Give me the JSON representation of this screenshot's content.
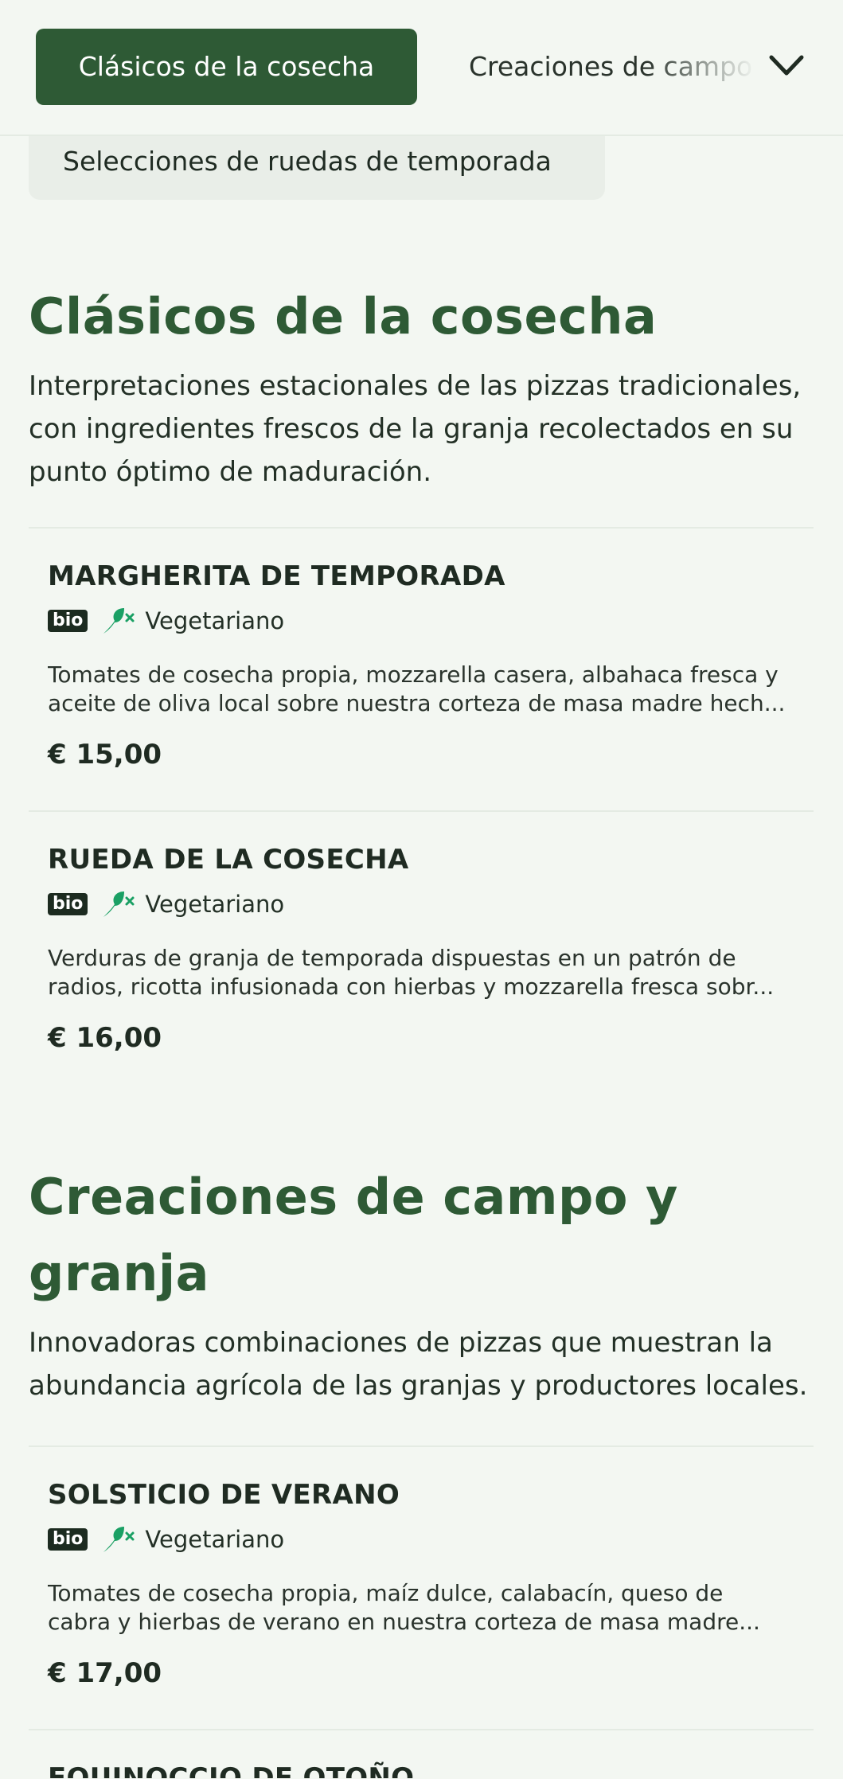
{
  "nav": {
    "active_tab": "Clásicos de la cosecha",
    "next_tab": "Creaciones de campo y granja",
    "subcategory": "Selecciones de ruedas de temporada"
  },
  "sections": [
    {
      "title": "Clásicos de la cosecha",
      "description": "Interpretaciones estacionales de las pizzas tradicionales, con ingredientes frescos de la granja recolectados en su punto óptimo de maduración.",
      "items": [
        {
          "name": "MARGHERITA DE TEMPORADA",
          "badge": "bio",
          "tag": "Vegetariano",
          "desc_line1": "Tomates de cosecha propia, mozzarella casera, albahaca fresca y",
          "desc_line2": "aceite de oliva local sobre nuestra corteza de masa madre hech...",
          "price": "€ 15,00"
        },
        {
          "name": "RUEDA DE LA COSECHA",
          "badge": "bio",
          "tag": "Vegetariano",
          "desc_line1": "Verduras de granja de temporada dispuestas en un patrón de",
          "desc_line2": "radios, ricotta infusionada con hierbas y mozzarella fresca sobr...",
          "price": "€ 16,00"
        }
      ]
    },
    {
      "title_line1": "Creaciones de campo y",
      "title_line2": "granja",
      "description": "Innovadoras combinaciones de pizzas que muestran la abundancia agrícola de las granjas y productores locales.",
      "items": [
        {
          "name": "SOLSTICIO DE VERANO",
          "badge": "bio",
          "tag": "Vegetariano",
          "desc_line1": "Tomates de cosecha propia, maíz dulce, calabacín, queso de",
          "desc_line2": "cabra y hierbas de verano en nuestra corteza de masa madre...",
          "price": "€ 17,00"
        },
        {
          "name": "EQUINOCCIO DE OTOÑO"
        }
      ]
    }
  ],
  "colors": {
    "accent": "#2e5a35",
    "background": "#f3f7f2",
    "leaf_icon": "#1aa064"
  },
  "icons": {
    "dropdown": "chevron-down-icon",
    "vegetarian": "leaf-no-meat-icon"
  }
}
